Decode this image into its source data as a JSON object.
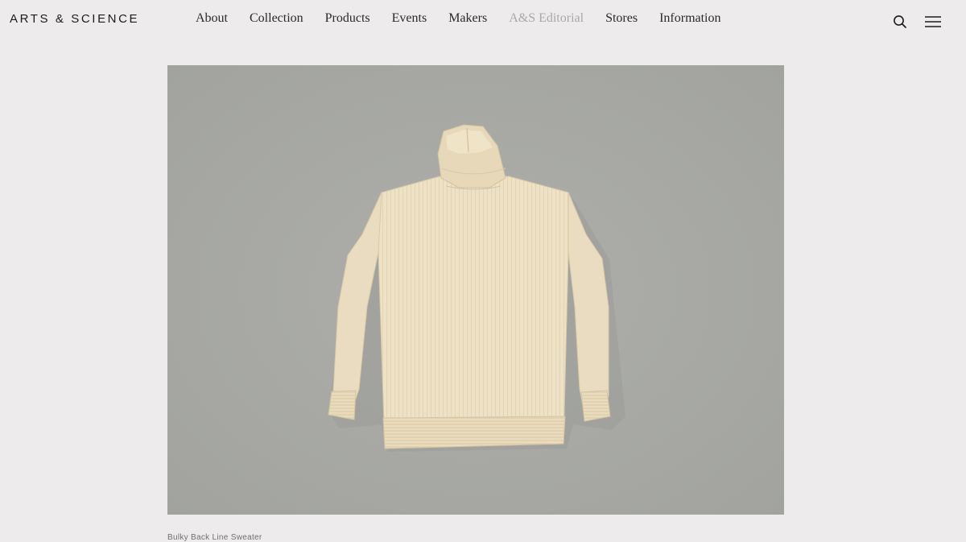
{
  "header": {
    "logo": "ARTS & SCIENCE",
    "nav": [
      {
        "label": "About"
      },
      {
        "label": "Collection"
      },
      {
        "label": "Products"
      },
      {
        "label": "Events"
      },
      {
        "label": "Makers"
      },
      {
        "label": "A&S Editorial"
      },
      {
        "label": "Stores"
      },
      {
        "label": "Information"
      }
    ],
    "icons": {
      "search": "search-icon",
      "menu": "hamburger-menu-icon"
    }
  },
  "main": {
    "product_caption": "Bulky Back Line Sweater"
  },
  "colors": {
    "background": "#edebeb",
    "photo_background": "#a8a9a5",
    "sweater": "#ede0c4",
    "text": "#2a2a2a",
    "nav_muted": "#a9a8a8"
  }
}
